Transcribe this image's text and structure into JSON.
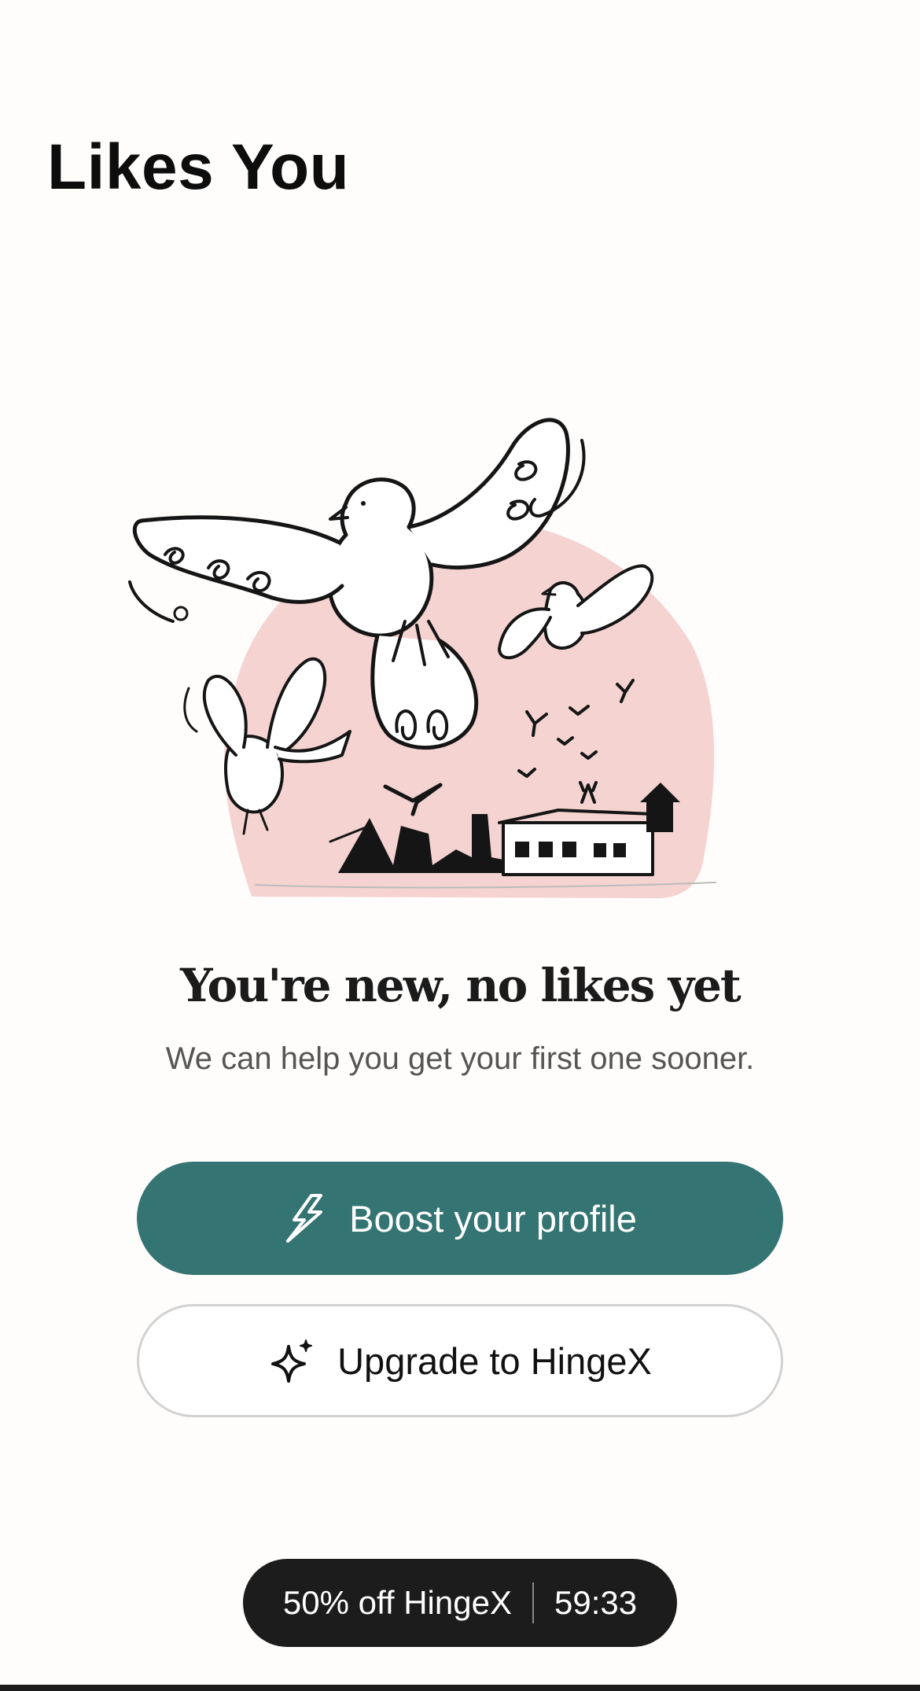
{
  "header": {
    "title": "Likes You"
  },
  "illustration": {
    "icon": "doves-flying-over-city-illustration",
    "accent_color": "#f4d3d1"
  },
  "empty_state": {
    "heading": "You're new, no likes yet",
    "subtext": "We can help you get your first one sooner."
  },
  "actions": {
    "boost": {
      "label": "Boost your profile",
      "icon": "lightning-bolt-icon",
      "color": "#347472"
    },
    "upgrade": {
      "label": "Upgrade to HingeX",
      "icon": "sparkle-icon"
    }
  },
  "promo": {
    "offer": "50% off HingeX",
    "timer": "59:33"
  }
}
